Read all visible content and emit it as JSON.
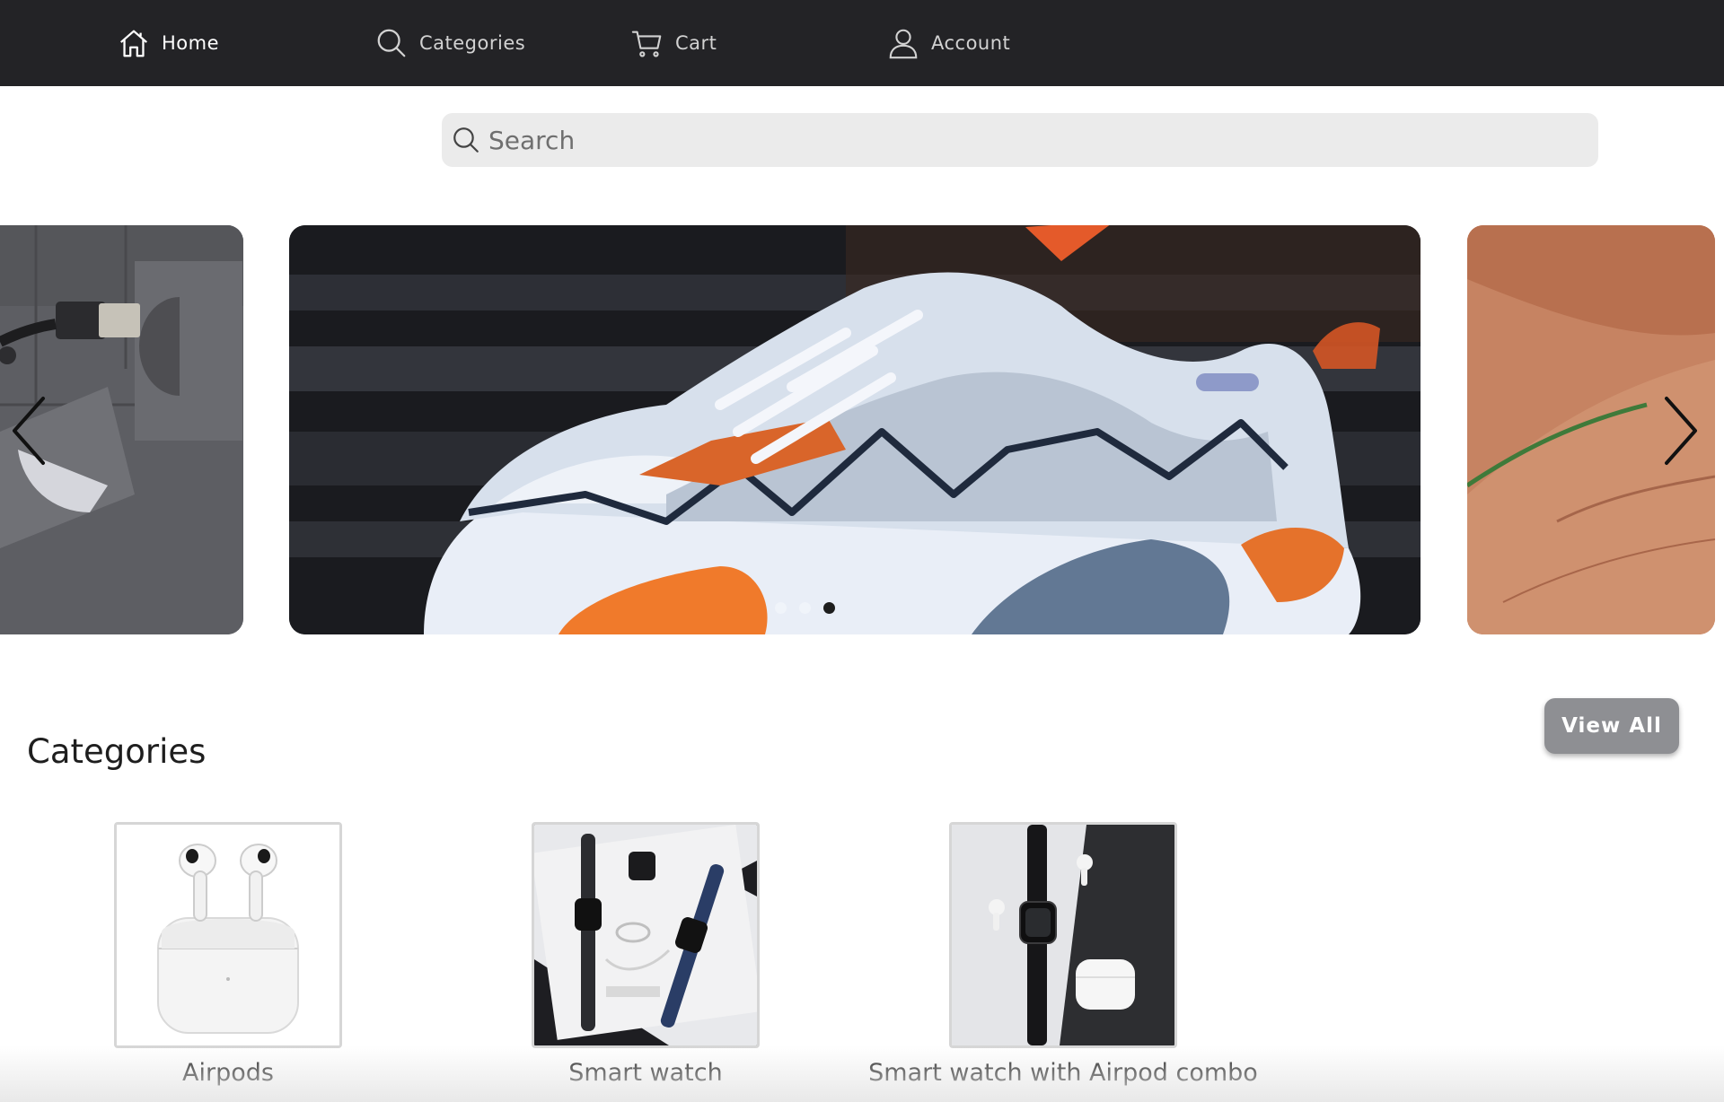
{
  "nav": {
    "items": [
      {
        "label": "Home",
        "icon": "home-icon",
        "active": true
      },
      {
        "label": "Categories",
        "icon": "search-icon",
        "active": false
      },
      {
        "label": "Cart",
        "icon": "cart-icon",
        "active": false
      },
      {
        "label": "Account",
        "icon": "user-icon",
        "active": false
      }
    ]
  },
  "search": {
    "placeholder": "Search",
    "value": ""
  },
  "carousel": {
    "slides": [
      "usb-cable-image",
      "sneaker-image",
      "hand-image"
    ],
    "active_slide": 3,
    "dot_count": 3
  },
  "categories": {
    "title": "Categories",
    "view_all": "View All",
    "items": [
      {
        "label": "Airpods",
        "image": "airpods-image"
      },
      {
        "label": "Smart watch",
        "image": "smart-watch-image"
      },
      {
        "label": "Smart watch with Airpod combo",
        "image": "watch-airpod-combo-image"
      }
    ]
  },
  "colors": {
    "nav_bg": "#232326",
    "button_bg": "#8e8f93",
    "search_bg": "#ebebeb"
  }
}
